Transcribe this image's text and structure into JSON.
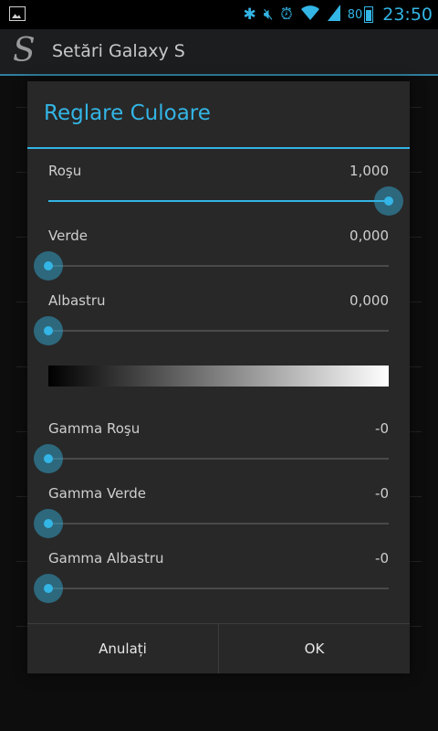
{
  "status_bar": {
    "icons": [
      "image-notification-icon",
      "bluetooth-icon",
      "mute-icon",
      "alarm-icon",
      "wifi-icon",
      "signal-icon",
      "battery-icon"
    ],
    "battery_level": "80",
    "time": "23:50"
  },
  "action_bar": {
    "title": "Setări Galaxy S",
    "logo_glyph": "S"
  },
  "dialog": {
    "title": "Reglare Culoare",
    "sliders": [
      {
        "label": "Roşu",
        "value_text": "1,000",
        "level": 1.0
      },
      {
        "label": "Verde",
        "value_text": "0,000",
        "level": 0.0
      },
      {
        "label": "Albastru",
        "value_text": "0,000",
        "level": 0.0
      }
    ],
    "gamma_sliders": [
      {
        "label": "Gamma Roşu",
        "value_text": "-0",
        "level": 0.0
      },
      {
        "label": "Gamma Verde",
        "value_text": "-0",
        "level": 0.0
      },
      {
        "label": "Gamma Albastru",
        "value_text": "-0",
        "level": 0.0
      }
    ],
    "cancel_label": "Anulați",
    "ok_label": "OK"
  },
  "colors": {
    "accent": "#33b5e5",
    "dialog_bg": "#282828",
    "track": "#4a4a4a"
  }
}
